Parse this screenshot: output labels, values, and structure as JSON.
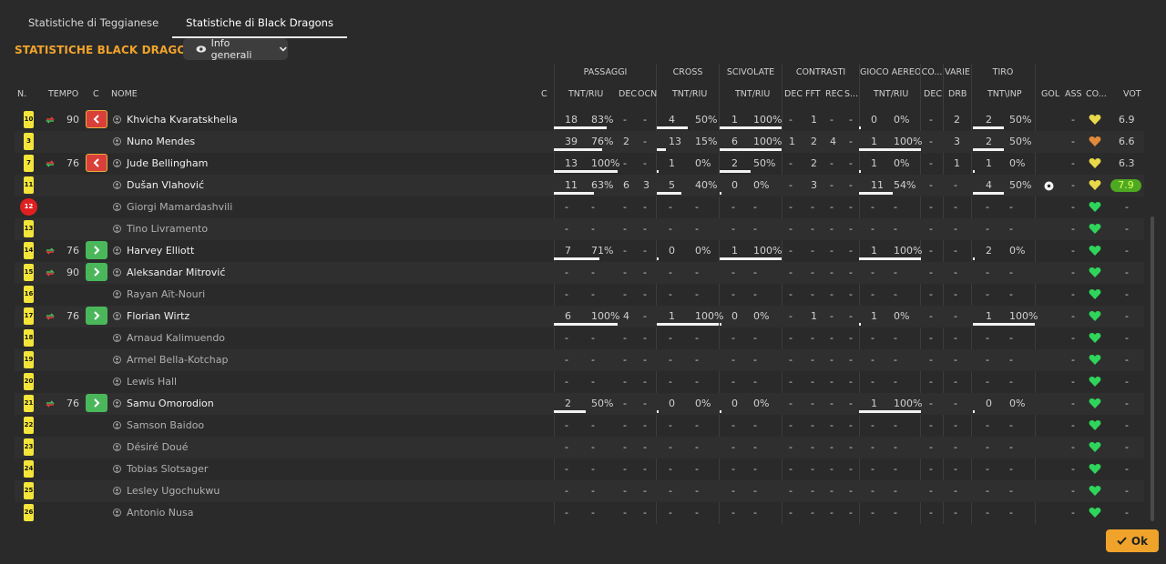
{
  "tabs": [
    "Statistiche di Teggianese",
    "Statistiche di Black Dragons"
  ],
  "title": "STATISTICHE BLACK DRAGONS",
  "view_dropdown": "Info generali",
  "groups": {
    "passaggi": "PASSAGGI",
    "cross": "CROSS",
    "scivolate": "SCIVOLATE",
    "contrasti": "CONTRASTI",
    "gioco_aereo": "GIOCO AEREO",
    "co": "CO...",
    "varie": "VARIE",
    "tiro": "TIRO"
  },
  "columns": {
    "n": "N.",
    "tempo": "TEMPO",
    "c": "C",
    "nome": "NOME",
    "c2": "C",
    "p_tnt": "TNT/RIU",
    "p_dec": "DEC",
    "p_ocn": "OCN",
    "cr_tnt": "TNT/RIU",
    "sc_tnt": "TNT/RIU",
    "ct_dec": "DEC",
    "ct_fft": "FFT",
    "ct_rec": "REC",
    "ct_s": "S...",
    "ga_tnt": "TNT/RIU",
    "co_dec": "DEC",
    "va_drb": "DRB",
    "ti_tnt": "TNT\\INP",
    "gol": "GOL",
    "ass": "ASS",
    "co2": "CO...",
    "vot": "VOT"
  },
  "players": [
    {
      "num": "10",
      "time": "90",
      "sub": "out",
      "name": "Khvicha Kvaratskhelia",
      "played": true,
      "p": [
        "18",
        "83%"
      ],
      "p_pct": 83,
      "p_dec": "-",
      "p_ocn": "-",
      "cr": [
        "4",
        "50%"
      ],
      "cr_pct": 50,
      "sc": [
        "1",
        "100%"
      ],
      "sc_pct": 100,
      "ct": [
        "-",
        "1",
        "-",
        "-"
      ],
      "ga": [
        "0",
        "0%"
      ],
      "ga_pct": 0,
      "co_dec": "-",
      "drb": "2",
      "ti": [
        "2",
        "50%"
      ],
      "ti_pct": 50,
      "gol": "",
      "ass": "-",
      "morale": "yellow",
      "vot": "6.9",
      "vot_good": false
    },
    {
      "num": "3",
      "time": "",
      "sub": "",
      "name": "Nuno Mendes",
      "played": true,
      "p": [
        "39",
        "76%"
      ],
      "p_pct": 76,
      "p_dec": "2",
      "p_ocn": "-",
      "cr": [
        "13",
        "15%"
      ],
      "cr_pct": 15,
      "sc": [
        "6",
        "100%"
      ],
      "sc_pct": 100,
      "ct": [
        "1",
        "2",
        "4",
        "-"
      ],
      "ga": [
        "1",
        "100%"
      ],
      "ga_pct": 100,
      "co_dec": "-",
      "drb": "3",
      "ti": [
        "2",
        "50%"
      ],
      "ti_pct": 50,
      "gol": "",
      "ass": "-",
      "morale": "orange",
      "vot": "6.6",
      "vot_good": false
    },
    {
      "num": "7",
      "time": "76",
      "sub": "out",
      "name": "Jude Bellingham",
      "played": true,
      "p": [
        "13",
        "100%"
      ],
      "p_pct": 100,
      "p_dec": "-",
      "p_ocn": "-",
      "cr": [
        "1",
        "0%"
      ],
      "cr_pct": 0,
      "sc": [
        "2",
        "50%"
      ],
      "sc_pct": 50,
      "ct": [
        "-",
        "2",
        "-",
        "-"
      ],
      "ga": [
        "1",
        "0%"
      ],
      "ga_pct": 0,
      "co_dec": "-",
      "drb": "1",
      "ti": [
        "1",
        "0%"
      ],
      "ti_pct": 0,
      "gol": "",
      "ass": "-",
      "morale": "yellow",
      "vot": "6.3",
      "vot_good": false
    },
    {
      "num": "11",
      "time": "",
      "sub": "",
      "name": "Dušan Vlahović",
      "played": true,
      "p": [
        "11",
        "63%"
      ],
      "p_pct": 63,
      "p_dec": "6",
      "p_ocn": "3",
      "cr": [
        "5",
        "40%"
      ],
      "cr_pct": 40,
      "sc": [
        "0",
        "0%"
      ],
      "sc_pct": 0,
      "ct": [
        "-",
        "3",
        "-",
        "-"
      ],
      "ga": [
        "11",
        "54%"
      ],
      "ga_pct": 54,
      "co_dec": "-",
      "drb": "-",
      "ti": [
        "4",
        "50%"
      ],
      "ti_pct": 50,
      "gol": "ball",
      "ass": "-",
      "morale": "yellow",
      "vot": "7.9",
      "vot_good": true
    },
    {
      "num": "12",
      "time": "",
      "sub": "",
      "name": "Giorgi Mamardashvili",
      "played": false,
      "keeper": true,
      "p": [
        "-",
        "-"
      ],
      "p_dec": "-",
      "p_ocn": "-",
      "cr": [
        "-",
        "-"
      ],
      "sc": [
        "-",
        "-"
      ],
      "ct": [
        "-",
        "-",
        "-",
        "-"
      ],
      "ga": [
        "-",
        "-"
      ],
      "co_dec": "-",
      "drb": "-",
      "ti": [
        "-",
        "-"
      ],
      "gol": "",
      "ass": "-",
      "morale": "green",
      "vot": "-",
      "vot_good": false
    },
    {
      "num": "13",
      "time": "",
      "sub": "",
      "name": "Tino Livramento",
      "played": false,
      "p": [
        "-",
        "-"
      ],
      "p_dec": "-",
      "p_ocn": "-",
      "cr": [
        "-",
        "-"
      ],
      "sc": [
        "-",
        "-"
      ],
      "ct": [
        "-",
        "-",
        "-",
        "-"
      ],
      "ga": [
        "-",
        "-"
      ],
      "co_dec": "-",
      "drb": "-",
      "ti": [
        "-",
        "-"
      ],
      "gol": "",
      "ass": "-",
      "morale": "green",
      "vot": "-",
      "vot_good": false
    },
    {
      "num": "14",
      "time": "76",
      "sub": "in",
      "name": "Harvey Elliott",
      "played": true,
      "p": [
        "7",
        "71%"
      ],
      "p_pct": 71,
      "p_dec": "-",
      "p_ocn": "-",
      "cr": [
        "0",
        "0%"
      ],
      "cr_pct": 0,
      "sc": [
        "1",
        "100%"
      ],
      "sc_pct": 100,
      "ct": [
        "-",
        "-",
        "-",
        "-"
      ],
      "ga": [
        "1",
        "100%"
      ],
      "ga_pct": 100,
      "co_dec": "-",
      "drb": "-",
      "ti": [
        "2",
        "0%"
      ],
      "ti_pct": 0,
      "gol": "",
      "ass": "-",
      "morale": "green",
      "vot": "-",
      "vot_good": false
    },
    {
      "num": "15",
      "time": "90",
      "sub": "in",
      "name": "Aleksandar Mitrović",
      "played": true,
      "p": [
        "-",
        "-"
      ],
      "p_dec": "-",
      "p_ocn": "-",
      "cr": [
        "-",
        "-"
      ],
      "sc": [
        "-",
        "-"
      ],
      "ct": [
        "-",
        "-",
        "-",
        "-"
      ],
      "ga": [
        "-",
        "-"
      ],
      "co_dec": "-",
      "drb": "-",
      "ti": [
        "-",
        "-"
      ],
      "gol": "",
      "ass": "-",
      "morale": "green",
      "vot": "-",
      "vot_good": false
    },
    {
      "num": "16",
      "time": "",
      "sub": "",
      "name": "Rayan Aït-Nouri",
      "played": false,
      "p": [
        "-",
        "-"
      ],
      "p_dec": "-",
      "p_ocn": "-",
      "cr": [
        "-",
        "-"
      ],
      "sc": [
        "-",
        "-"
      ],
      "ct": [
        "-",
        "-",
        "-",
        "-"
      ],
      "ga": [
        "-",
        "-"
      ],
      "co_dec": "-",
      "drb": "-",
      "ti": [
        "-",
        "-"
      ],
      "gol": "",
      "ass": "-",
      "morale": "green",
      "vot": "-",
      "vot_good": false
    },
    {
      "num": "17",
      "time": "76",
      "sub": "in",
      "name": "Florian Wirtz",
      "played": true,
      "p": [
        "6",
        "100%"
      ],
      "p_pct": 100,
      "p_dec": "4",
      "p_ocn": "-",
      "cr": [
        "1",
        "100%"
      ],
      "cr_pct": 100,
      "sc": [
        "0",
        "0%"
      ],
      "sc_pct": 0,
      "ct": [
        "-",
        "1",
        "-",
        "-"
      ],
      "ga": [
        "1",
        "0%"
      ],
      "ga_pct": 0,
      "co_dec": "-",
      "drb": "-",
      "ti": [
        "1",
        "100%"
      ],
      "ti_pct": 100,
      "gol": "",
      "ass": "-",
      "morale": "green",
      "vot": "-",
      "vot_good": false
    },
    {
      "num": "18",
      "time": "",
      "sub": "",
      "name": "Arnaud Kalimuendo",
      "played": false,
      "p": [
        "-",
        "-"
      ],
      "p_dec": "-",
      "p_ocn": "-",
      "cr": [
        "-",
        "-"
      ],
      "sc": [
        "-",
        "-"
      ],
      "ct": [
        "-",
        "-",
        "-",
        "-"
      ],
      "ga": [
        "-",
        "-"
      ],
      "co_dec": "-",
      "drb": "-",
      "ti": [
        "-",
        "-"
      ],
      "gol": "",
      "ass": "-",
      "morale": "green",
      "vot": "-",
      "vot_good": false
    },
    {
      "num": "19",
      "time": "",
      "sub": "",
      "name": "Armel Bella-Kotchap",
      "played": false,
      "p": [
        "-",
        "-"
      ],
      "p_dec": "-",
      "p_ocn": "-",
      "cr": [
        "-",
        "-"
      ],
      "sc": [
        "-",
        "-"
      ],
      "ct": [
        "-",
        "-",
        "-",
        "-"
      ],
      "ga": [
        "-",
        "-"
      ],
      "co_dec": "-",
      "drb": "-",
      "ti": [
        "-",
        "-"
      ],
      "gol": "",
      "ass": "-",
      "morale": "green",
      "vot": "-",
      "vot_good": false
    },
    {
      "num": "20",
      "time": "",
      "sub": "",
      "name": "Lewis Hall",
      "played": false,
      "p": [
        "-",
        "-"
      ],
      "p_dec": "-",
      "p_ocn": "-",
      "cr": [
        "-",
        "-"
      ],
      "sc": [
        "-",
        "-"
      ],
      "ct": [
        "-",
        "-",
        "-",
        "-"
      ],
      "ga": [
        "-",
        "-"
      ],
      "co_dec": "-",
      "drb": "-",
      "ti": [
        "-",
        "-"
      ],
      "gol": "",
      "ass": "-",
      "morale": "green",
      "vot": "-",
      "vot_good": false
    },
    {
      "num": "21",
      "time": "76",
      "sub": "in",
      "name": "Samu Omorodion",
      "played": true,
      "p": [
        "2",
        "50%"
      ],
      "p_pct": 50,
      "p_dec": "-",
      "p_ocn": "-",
      "cr": [
        "0",
        "0%"
      ],
      "cr_pct": 0,
      "sc": [
        "0",
        "0%"
      ],
      "sc_pct": 0,
      "ct": [
        "-",
        "-",
        "-",
        "-"
      ],
      "ga": [
        "1",
        "100%"
      ],
      "ga_pct": 100,
      "co_dec": "-",
      "drb": "-",
      "ti": [
        "0",
        "0%"
      ],
      "ti_pct": 0,
      "gol": "",
      "ass": "-",
      "morale": "green",
      "vot": "-",
      "vot_good": false
    },
    {
      "num": "22",
      "time": "",
      "sub": "",
      "name": "Samson Baidoo",
      "played": false,
      "p": [
        "-",
        "-"
      ],
      "p_dec": "-",
      "p_ocn": "-",
      "cr": [
        "-",
        "-"
      ],
      "sc": [
        "-",
        "-"
      ],
      "ct": [
        "-",
        "-",
        "-",
        "-"
      ],
      "ga": [
        "-",
        "-"
      ],
      "co_dec": "-",
      "drb": "-",
      "ti": [
        "-",
        "-"
      ],
      "gol": "",
      "ass": "-",
      "morale": "green",
      "vot": "-",
      "vot_good": false
    },
    {
      "num": "23",
      "time": "",
      "sub": "",
      "name": "Désiré Doué",
      "played": false,
      "p": [
        "-",
        "-"
      ],
      "p_dec": "-",
      "p_ocn": "-",
      "cr": [
        "-",
        "-"
      ],
      "sc": [
        "-",
        "-"
      ],
      "ct": [
        "-",
        "-",
        "-",
        "-"
      ],
      "ga": [
        "-",
        "-"
      ],
      "co_dec": "-",
      "drb": "-",
      "ti": [
        "-",
        "-"
      ],
      "gol": "",
      "ass": "-",
      "morale": "green",
      "vot": "-",
      "vot_good": false
    },
    {
      "num": "24",
      "time": "",
      "sub": "",
      "name": "Tobias Slotsager",
      "played": false,
      "p": [
        "-",
        "-"
      ],
      "p_dec": "-",
      "p_ocn": "-",
      "cr": [
        "-",
        "-"
      ],
      "sc": [
        "-",
        "-"
      ],
      "ct": [
        "-",
        "-",
        "-",
        "-"
      ],
      "ga": [
        "-",
        "-"
      ],
      "co_dec": "-",
      "drb": "-",
      "ti": [
        "-",
        "-"
      ],
      "gol": "",
      "ass": "-",
      "morale": "green",
      "vot": "-",
      "vot_good": false
    },
    {
      "num": "25",
      "time": "",
      "sub": "",
      "name": "Lesley Ugochukwu",
      "played": false,
      "p": [
        "-",
        "-"
      ],
      "p_dec": "-",
      "p_ocn": "-",
      "cr": [
        "-",
        "-"
      ],
      "sc": [
        "-",
        "-"
      ],
      "ct": [
        "-",
        "-",
        "-",
        "-"
      ],
      "ga": [
        "-",
        "-"
      ],
      "co_dec": "-",
      "drb": "-",
      "ti": [
        "-",
        "-"
      ],
      "gol": "",
      "ass": "-",
      "morale": "green",
      "vot": "-",
      "vot_good": false
    },
    {
      "num": "26",
      "time": "",
      "sub": "",
      "name": "Antonio Nusa",
      "played": false,
      "p": [
        "-",
        "-"
      ],
      "p_dec": "-",
      "p_ocn": "-",
      "cr": [
        "-",
        "-"
      ],
      "sc": [
        "-",
        "-"
      ],
      "ct": [
        "-",
        "-",
        "-",
        "-"
      ],
      "ga": [
        "-",
        "-"
      ],
      "co_dec": "-",
      "drb": "-",
      "ti": [
        "-",
        "-"
      ],
      "gol": "",
      "ass": "-",
      "morale": "green",
      "vot": "-",
      "vot_good": false
    }
  ],
  "ok_button": "Ok",
  "colors": {
    "accent": "#f0a32a",
    "shirt": "#f3e53a",
    "sub_out": "#d9403a",
    "sub_in": "#4bb75b",
    "good_rating": "#4ea822"
  }
}
